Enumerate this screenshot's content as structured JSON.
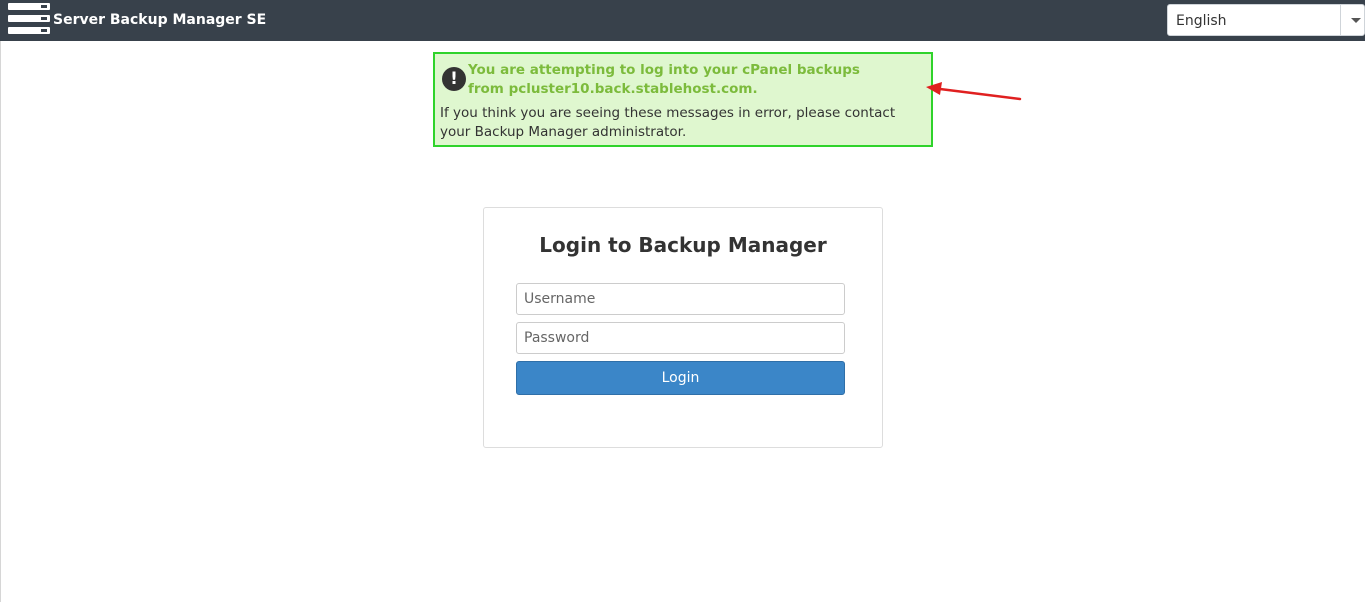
{
  "header": {
    "app_title": "Server Backup Manager SE",
    "brand_icon": "server-rack-icon",
    "language": {
      "selected": "English",
      "caret_icon": "caret-down-icon"
    }
  },
  "alert": {
    "icon": "exclamation-circle-icon",
    "title": "You are attempting to log into your cPanel backups from pcluster10.back.stablehost.com.",
    "body": "If you think you are seeing these messages in error, please contact your Backup Manager administrator.",
    "background_color": "#dff7cf",
    "border_color": "#2fd32b",
    "title_color": "#7cbb3c"
  },
  "annotation": {
    "arrow_color": "#e02020"
  },
  "login": {
    "title": "Login to Backup Manager",
    "username_placeholder": "Username",
    "password_placeholder": "Password",
    "submit_label": "Login",
    "button_color": "#3b86c8"
  },
  "colors": {
    "topbar": "#38414b"
  }
}
